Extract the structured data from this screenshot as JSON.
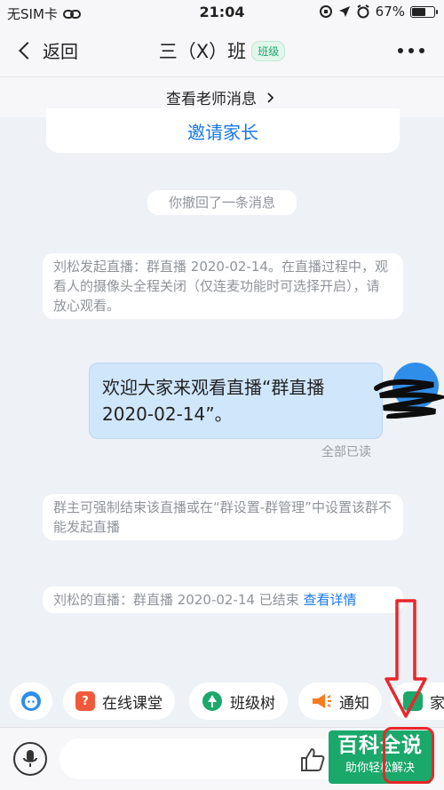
{
  "status_bar": {
    "carrier": "无SIM卡",
    "time": "21:04",
    "battery": "67%",
    "battery_level": 0.67
  },
  "nav": {
    "back_label": "返回",
    "title": "三（X）班",
    "badge": "班级"
  },
  "teacher_bar": {
    "label": "查看老师消息"
  },
  "chat": {
    "invite_label": "邀请家长",
    "recall_notice": "你撤回了一条消息",
    "live_start_notice": "刘松发起直播：群直播 2020-02-14。在直播过程中，观看人的摄像头全程关闭（仅连麦功能时可选择开启），请放心观看。",
    "message_line1": "欢迎大家来观看直播“群直播",
    "message_line2": "2020-02-14”。",
    "read_status": "全部已读",
    "force_end_notice": "群主可强制结束该直播或在“群设置-群管理”中设置该群不能发起直播",
    "live_end_notice": "刘松的直播：群直播 2020-02-14 已结束 ",
    "live_end_link": "查看详情"
  },
  "toolbar": {
    "items": [
      {
        "label": "在线课堂",
        "color": "#f05a3c"
      },
      {
        "label": "班级树",
        "color": "#1aa86b"
      },
      {
        "label": "通知",
        "color": "#f57c1f"
      },
      {
        "label": "家",
        "color": "#1aa86b"
      }
    ]
  },
  "input_bar": {
    "placeholder": ""
  },
  "watermark": {
    "title": "百科全说",
    "subtitle": "助你轻松解决"
  },
  "colors": {
    "accent_blue": "#1877e8",
    "brand_green": "#1aa86b",
    "bubble_blue": "#cfe6fb",
    "annotation_red": "#e8272b"
  }
}
